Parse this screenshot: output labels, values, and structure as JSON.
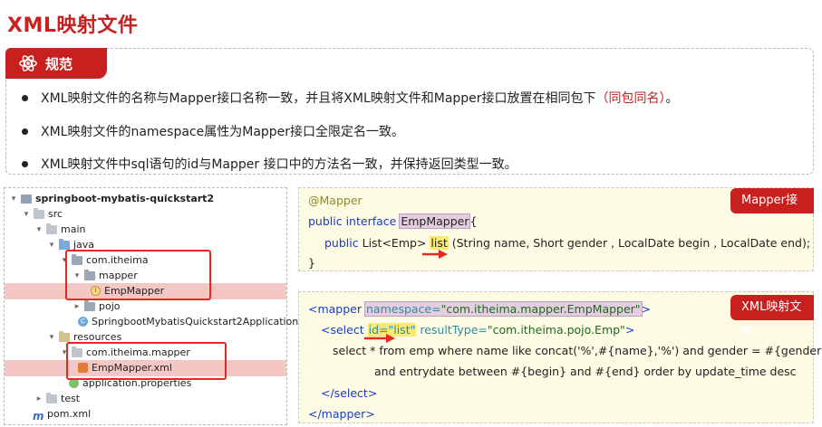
{
  "page_title": "XML映射文件",
  "rules": {
    "tab_label": "规范",
    "items": [
      {
        "text": "XML映射文件的名称与Mapper接口名称一致，并且将XML映射文件和Mapper接口放置在相同包下",
        "highlight": "（同包同名）",
        "tail": "。"
      },
      {
        "text": "XML映射文件的namespace属性为Mapper接口全限定名一致。",
        "highlight": "",
        "tail": ""
      },
      {
        "text": "XML映射文件中sql语句的id与Mapper 接口中的方法名一致，并保持返回类型一致。",
        "highlight": "",
        "tail": ""
      }
    ]
  },
  "tree": {
    "nodes": [
      {
        "label": "springboot-mybatis-quickstart2",
        "icon": "project-icon"
      },
      {
        "label": "src",
        "icon": "folder-icon"
      },
      {
        "label": "main",
        "icon": "folder-icon"
      },
      {
        "label": "java",
        "icon": "source-folder-icon"
      },
      {
        "label": "com.itheima",
        "icon": "package-icon"
      },
      {
        "label": "mapper",
        "icon": "package-icon"
      },
      {
        "label": "EmpMapper",
        "icon": "interface-icon"
      },
      {
        "label": "pojo",
        "icon": "package-icon"
      },
      {
        "label": "SpringbootMybatisQuickstart2Application",
        "icon": "class-icon"
      },
      {
        "label": "resources",
        "icon": "resources-folder-icon"
      },
      {
        "label": "com.itheima.mapper",
        "icon": "folder-icon"
      },
      {
        "label": "EmpMapper.xml",
        "icon": "xml-file-icon"
      },
      {
        "label": "application.properties",
        "icon": "properties-icon"
      },
      {
        "label": "test",
        "icon": "folder-icon"
      },
      {
        "label": "pom.xml",
        "icon": "maven-icon"
      }
    ],
    "interface_letter": "I",
    "class_letter": "C",
    "maven_letter": "m"
  },
  "java_code": {
    "badge": "Mapper接口",
    "line1": "@Mapper",
    "line2_kw": "public interface",
    "line2_name": "EmpMapper",
    "line2_tail": "{",
    "line3_kw": "public",
    "line3_type": "List<Emp>",
    "line3_method": "list",
    "line3_params": "(String name, Short gender , LocalDate begin , LocalDate end);",
    "line4": "}"
  },
  "xml_code": {
    "badge": "XML映射文件",
    "l1_open": "<mapper",
    "l1_attr": "namespace=",
    "l1_val": "\"com.itheima.mapper.EmpMapper\"",
    "l1_close": ">",
    "l2_open": "<select",
    "l2_id": "id=\"list\"",
    "l2_attr": "resultType=",
    "l2_val": "\"com.itheima.pojo.Emp\"",
    "l2_close": ">",
    "l3": "select * from emp where name like concat('%',#{name},'%') and gender = #{gender}",
    "l4": "and entrydate between #{begin} and #{end} order by update_time desc",
    "l5": "</select>",
    "l6": "</mapper>"
  },
  "colors": {
    "accent": "#c7201f",
    "highlight_row": "#f3c7c4",
    "code_bg": "#fdfbe3"
  }
}
